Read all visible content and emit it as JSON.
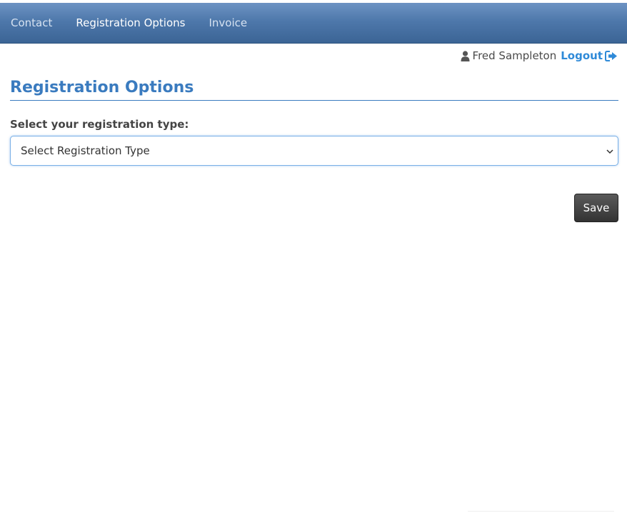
{
  "nav": {
    "items": [
      {
        "label": "Contact",
        "active": false
      },
      {
        "label": "Registration Options",
        "active": true
      },
      {
        "label": "Invoice",
        "active": false
      }
    ]
  },
  "user": {
    "icon": "user-icon",
    "name": "Fred Sampleton",
    "logout_label": "Logout",
    "logout_icon": "sign-out-icon"
  },
  "page": {
    "title": "Registration Options",
    "field_label": "Select your registration type:",
    "select_value": "Select Registration Type",
    "save_label": "Save"
  },
  "colors": {
    "nav_gradient_top": "#6d93c3",
    "nav_gradient_bottom": "#3b6495",
    "title": "#3a7bbf",
    "logout": "#2f8ad8",
    "save_button": "#3a3a3a"
  }
}
